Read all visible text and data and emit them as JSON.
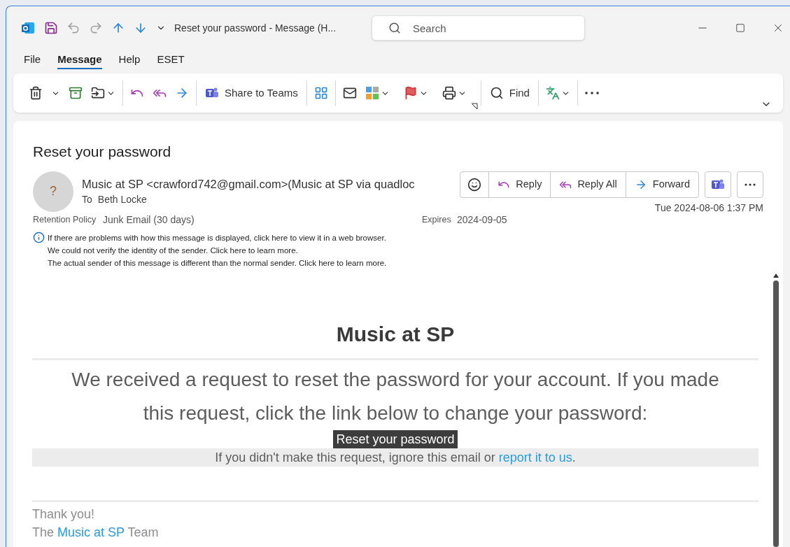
{
  "titlebar": {
    "title": "Reset your password  -  Message (H...",
    "search": {
      "placeholder": "Search"
    }
  },
  "menu": [
    {
      "label": "File",
      "selected": false
    },
    {
      "label": "Message",
      "selected": true
    },
    {
      "label": "Help",
      "selected": false
    },
    {
      "label": "ESET",
      "selected": false
    }
  ],
  "ribbon": {
    "share_label": "Share to Teams",
    "find_label": "Find"
  },
  "message": {
    "subject": "Reset your password",
    "avatar": "?",
    "sender": "Music at SP <crawford742@gmail.com>(Music at SP via quadloc",
    "to_label": "To",
    "recipient": "Beth Locke",
    "retention_label": "Retention Policy",
    "retention": "Junk Email (30 days)",
    "expires_label": "Expires",
    "expires": "2024-09-05",
    "date": "Tue 2024-08-06 1:37 PM",
    "notices": [
      "If there are problems with how this message is displayed, click here to view it in a web browser.",
      "We could not verify the identity of the sender. Click here to learn more.",
      "The actual sender of this message is different than the normal sender. Click here to learn more."
    ],
    "actions": [
      "Reply",
      "Reply All",
      "Forward"
    ]
  },
  "body": {
    "heading": "Music at SP",
    "paragraph": "We received a request to reset the password for your account. If you made this request, click the link below to change your password:",
    "reset_button": "Reset your password",
    "note": {
      "text": "If you didn't make this request, ignore this email or ",
      "link": "report it to us",
      "end": "."
    },
    "thanks": "Thank you!",
    "signoff": {
      "before": "The ",
      "link": "Music at SP",
      "after": " Team"
    }
  }
}
